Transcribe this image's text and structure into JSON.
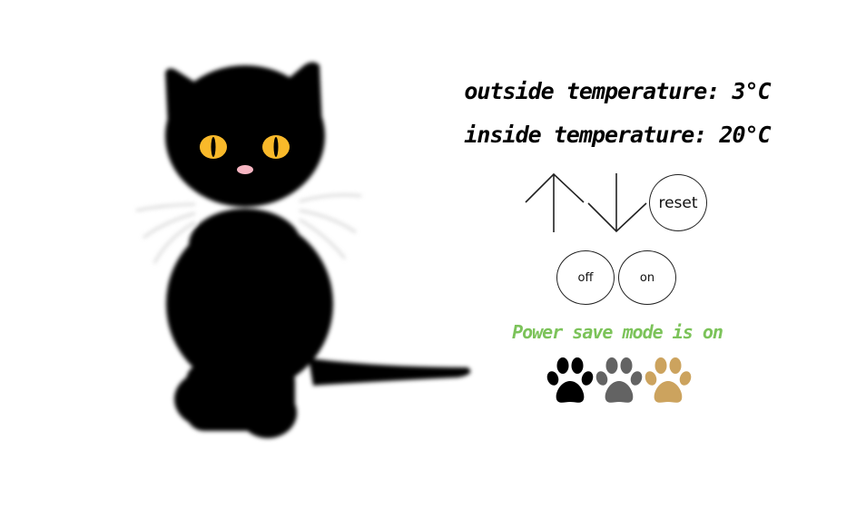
{
  "readings": {
    "outside": "outside temperature: 3°C",
    "inside": "inside temperature: 20°C"
  },
  "controls": {
    "up_icon": "arrow-up-icon",
    "down_icon": "arrow-down-icon",
    "reset_label": "reset",
    "off_label": "off",
    "on_label": "on"
  },
  "status": {
    "text": "Power save mode is on",
    "color": "#7cc35a"
  },
  "paws": [
    {
      "icon": "paw-icon",
      "color": "#000000"
    },
    {
      "icon": "paw-icon",
      "color": "#636363"
    },
    {
      "icon": "paw-icon",
      "color": "#cca35e"
    }
  ],
  "cat": {
    "body_color": "#000000",
    "eye_color": "#f9b92a",
    "nose_color": "#f7b6c2"
  }
}
